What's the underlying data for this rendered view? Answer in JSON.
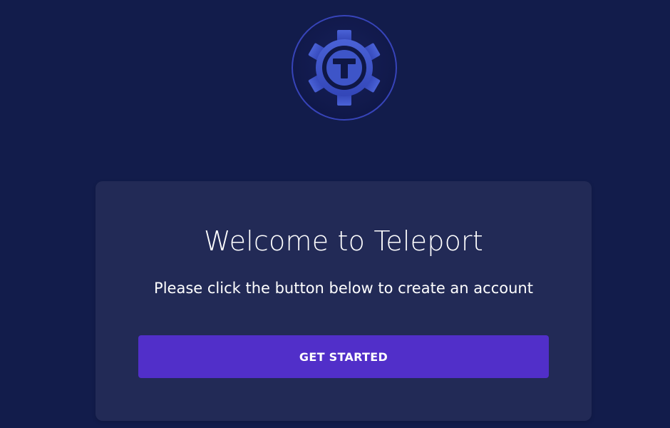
{
  "app": {
    "logo_icon": "teleport-gear-logo-icon",
    "logo_letter": "T"
  },
  "welcome": {
    "title": "Welcome to Teleport",
    "subtitle": "Please click the button below to create an account",
    "cta_label": "GET STARTED"
  },
  "colors": {
    "background": "#121c4b",
    "card": "#222a56",
    "button": "#512fc9",
    "text": "#ffffff"
  }
}
